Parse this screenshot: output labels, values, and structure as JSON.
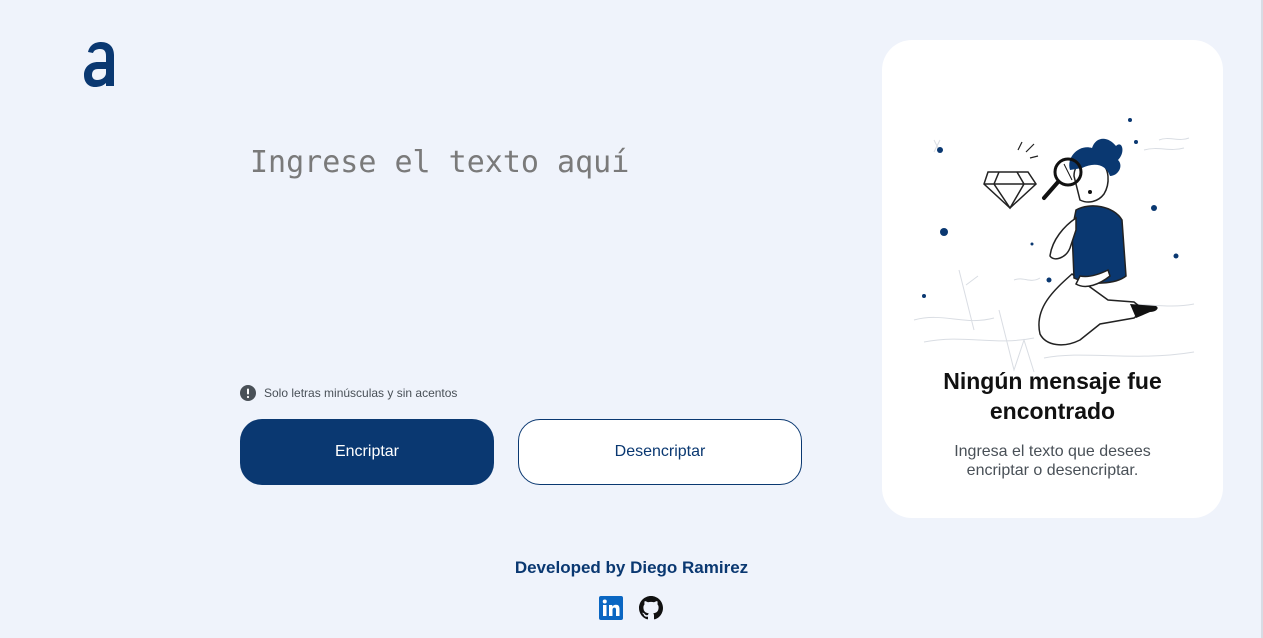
{
  "logo": {
    "icon": "alura-a-logo-icon"
  },
  "input": {
    "placeholder": "Ingrese el texto aquí",
    "value": ""
  },
  "hint": {
    "icon": "exclamation-circle-icon",
    "text": "Solo letras minúsculas y sin acentos"
  },
  "buttons": {
    "encrypt_label": "Encriptar",
    "decrypt_label": "Desencriptar"
  },
  "output_card": {
    "title": "Ningún mensaje fue encontrado",
    "text": "Ingresa el texto que desees encriptar o desencriptar.",
    "illustration": "person-with-magnifier-illustration"
  },
  "footer": {
    "text": "Developed by Diego Ramirez",
    "links": [
      {
        "name": "linkedin",
        "icon": "linkedin-icon"
      },
      {
        "name": "github",
        "icon": "github-icon"
      }
    ]
  },
  "colors": {
    "primary": "#0a3871",
    "background": "#eff3fb",
    "card": "#ffffff",
    "muted_text": "#495057"
  }
}
